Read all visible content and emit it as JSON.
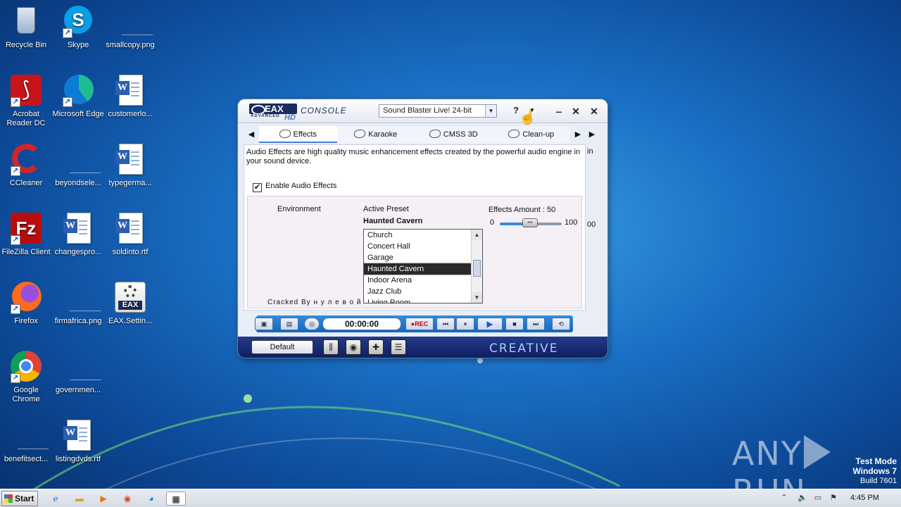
{
  "desktop": {
    "icons": [
      {
        "label": "Recycle Bin"
      },
      {
        "label": "Skype"
      },
      {
        "label": "smallcopy.png"
      },
      {
        "label": "Acrobat Reader DC"
      },
      {
        "label": "Microsoft Edge"
      },
      {
        "label": "customerlo..."
      },
      {
        "label": "CCleaner"
      },
      {
        "label": "beyondsele..."
      },
      {
        "label": "typegerma..."
      },
      {
        "label": "FileZilla Client"
      },
      {
        "label": "changespro..."
      },
      {
        "label": "soldinto.rtf"
      },
      {
        "label": "Firefox"
      },
      {
        "label": "firmafrica.png"
      },
      {
        "label": "EAX.Settin..."
      },
      {
        "label": "Google Chrome"
      },
      {
        "label": "governmen..."
      },
      {
        "label": "benefitsect..."
      },
      {
        "label": "listingdvds.rtf"
      }
    ]
  },
  "eax": {
    "logo": {
      "text": "EAX",
      "sub": "ADVANCED",
      "hd": "HD"
    },
    "console_label": "CONSOLE",
    "device": "Sound Blaster Live! 24-bit",
    "help": "?",
    "tabs": [
      {
        "label": "Effects"
      },
      {
        "label": "Karaoke"
      },
      {
        "label": "CMSS 3D"
      },
      {
        "label": "Clean-up"
      }
    ],
    "description": "Audio Effects are high quality music enhancement effects created by the powerful audio engine in your sound device.",
    "description_clip": "in",
    "enable_label": "Enable Audio Effects",
    "environment_label": "Environment",
    "active_preset_label": "Active Preset",
    "active_preset_value": "Haunted Cavern",
    "effects_amount_label": "Effects Amount : 50",
    "effects_amount": 50,
    "slider_min": "0",
    "slider_max": "100",
    "slider_max_clip": "00",
    "presets": [
      "Church",
      "Concert Hall",
      "Garage",
      "Haunted Cavern",
      "Indoor Arena",
      "Jazz Club",
      "Living Room"
    ],
    "selected_preset": "Haunted Cavern",
    "cracked_by": "Cracked By н у л е в о й",
    "time": "00:00:00",
    "rec": "REC",
    "default_button": "Default",
    "brand": "CREATIVE"
  },
  "watermark": {
    "text_left": "ANY",
    "text_right": "RUN",
    "test_mode": "Test Mode",
    "os": "Windows 7",
    "build": "Build 7601"
  },
  "taskbar": {
    "start": "Start",
    "clock": "4:45 PM"
  }
}
